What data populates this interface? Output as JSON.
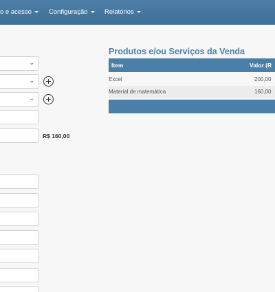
{
  "navbar": {
    "items": [
      {
        "label": "o e acesso"
      },
      {
        "label": "Configuração"
      },
      {
        "label": "Relatórios"
      }
    ]
  },
  "form": {
    "total": "R$ 160,00"
  },
  "products_panel": {
    "title": "Produtos e/ou Serviços da Venda",
    "columns": [
      "Item",
      "Valor (R"
    ],
    "rows": [
      {
        "item": "Excel",
        "value": "200,00"
      },
      {
        "item": "Material de matemática",
        "value": "160,00"
      }
    ]
  },
  "colors": {
    "navbar": "#4a7fa7",
    "table_header": "#4a7fa7",
    "title": "#4a7fa7",
    "row_alt": "#ececec"
  }
}
